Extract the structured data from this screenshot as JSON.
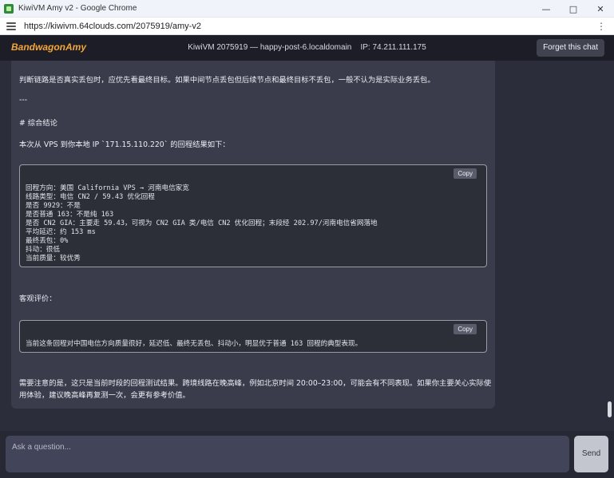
{
  "window": {
    "title": "KiwiVM Amy v2 - Google Chrome",
    "controls": {
      "minimize": "—",
      "maximize": "□",
      "close": "✕"
    }
  },
  "addressbar": {
    "url": "https://kiwivm.64clouds.com/2075919/amy-v2"
  },
  "header": {
    "brand": "BandwagonAmy",
    "info": "KiwiVM 2075919 — happy-post-6.localdomain    IP: 74.211.111.175",
    "forget_label": "Forget this chat"
  },
  "message": {
    "p1": "判断链路是否真实丢包时，应优先看最终目标。如果中间节点丢包但后续节点和最终目标不丢包，一般不认为是实际业务丢包。",
    "hr": "---",
    "heading": "# 综合结论",
    "intro": "本次从 VPS 到你本地 IP `171.15.110.220` 的回程结果如下：",
    "code1": {
      "copy": "Copy",
      "lines": [
        "回程方向：美国 California VPS → 河南电信家宽",
        "线路类型：电信 CN2 / 59.43 优化回程",
        "是否 9929：不是",
        "是否普通 163：不是纯 163",
        "是否 CN2 GIA：主要走 59.43，可视为 CN2 GIA 类/电信 CN2 优化回程；末段经 202.97/河南电信省网落地",
        "平均延迟：约 153 ms",
        "最终丢包：0%",
        "抖动：很低",
        "当前质量：较优秀"
      ]
    },
    "eval_label": "客观评价：",
    "code2": {
      "copy": "Copy",
      "lines": [
        "当前这条回程对中国电信方向质量很好，延迟低、最终无丢包、抖动小，明显优于普通 163 回程的典型表现。"
      ]
    },
    "note_line1": "需要注意的是，这只是当前时段的回程测试结果。跨境线路在晚高峰，例如北京时间 20:00–23:00，可能会有不同表现。如果你主要关心实际使",
    "note_line2": "用体验，建议晚高峰再复测一次，会更有参考价值。"
  },
  "input": {
    "placeholder": "Ask a question...",
    "send_label": "Send"
  },
  "colors": {
    "brand": "#f4a63a",
    "app_bg": "#2b2d3a",
    "bubble": "#3a3c4c",
    "code_bg": "#2c2e38"
  }
}
